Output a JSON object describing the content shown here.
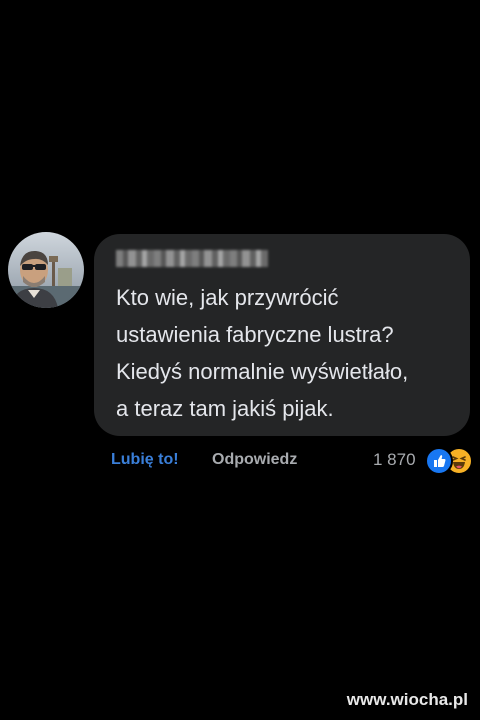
{
  "comment": {
    "author_name": "",
    "text": "Kto wie, jak przywrócić\nustawienia fabryczne lustra?\nKiedyś normalnie wyświetłało,\na teraz tam jakiś pijak."
  },
  "actions": {
    "like_label": "Lubię to!",
    "reply_label": "Odpowiedz",
    "reaction_count": "1 870",
    "reactions": [
      "like-icon",
      "haha-icon"
    ]
  },
  "watermark": "www.wiocha.pl",
  "colors": {
    "background": "#000000",
    "bubble": "#242526",
    "text": "#e4e6eb",
    "like_link": "#3a7fd9",
    "muted": "#a8abaf",
    "like_reaction": "#1877f2",
    "haha_reaction": "#f7b125"
  }
}
